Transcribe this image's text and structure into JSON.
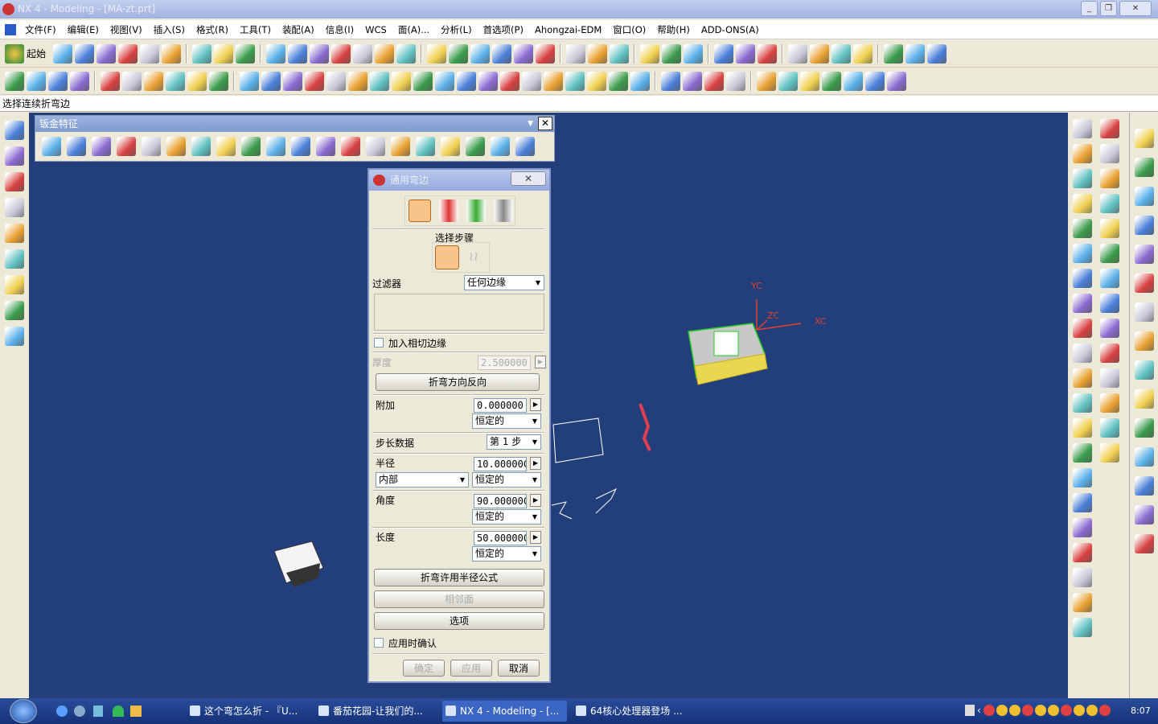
{
  "window": {
    "title": "NX 4 - Modeling - [MA-zt.prt]",
    "controls": [
      "minimize",
      "restore",
      "close"
    ]
  },
  "menu": [
    "文件(F)",
    "编辑(E)",
    "视图(V)",
    "插入(S)",
    "格式(R)",
    "工具(T)",
    "装配(A)",
    "信息(I)",
    "WCS",
    "面(A)...",
    "分析(L)",
    "首选项(P)",
    "Ahongzai-EDM",
    "窗口(O)",
    "帮助(H)",
    "ADD-ONS(A)"
  ],
  "toolbar": {
    "start_label": "起始"
  },
  "cue_line": "选择连续折弯边",
  "sheet_toolbar": {
    "title": "钣金特征"
  },
  "viewport": {
    "background": "#233f7b",
    "axes": {
      "x": "XC",
      "y": "YC",
      "z": "ZC"
    },
    "axis_color": "#e0402a"
  },
  "dialog": {
    "title": "通用弯边",
    "step_label": "选择步骤",
    "filter_label": "过滤器",
    "filter_value": "任何边缘",
    "tangent_label": "加入相切边缘",
    "tangent_checked": false,
    "thickness_label": "厚度",
    "thickness_value": "2.500000",
    "reverse_button": "折弯方向反向",
    "add_label": "附加",
    "add_value": "0.000000",
    "add_mode": "恒定的",
    "step_data_label": "步长数据",
    "step_value": "第 1 步",
    "radius_label": "半径",
    "radius_value": "10.00000C",
    "radius_side": "内部",
    "radius_mode": "恒定的",
    "angle_label": "角度",
    "angle_value": "90.00000C",
    "angle_mode": "恒定的",
    "length_label": "长度",
    "length_value": "50.00000C",
    "length_mode": "恒定的",
    "formula_button": "折弯许用半径公式",
    "adjacent_button": "相邻面",
    "options_button": "选项",
    "confirm_label": "应用时确认",
    "confirm_checked": false,
    "ok": "确定",
    "apply": "应用",
    "cancel": "取消"
  },
  "taskbar": {
    "tasks": [
      "这个弯怎么折 - 『U...",
      "番茄花园-让我们的...",
      "NX 4 - Modeling - [...",
      "64核心处理器登场 ..."
    ],
    "active_index": 2,
    "clock": "8:07"
  }
}
